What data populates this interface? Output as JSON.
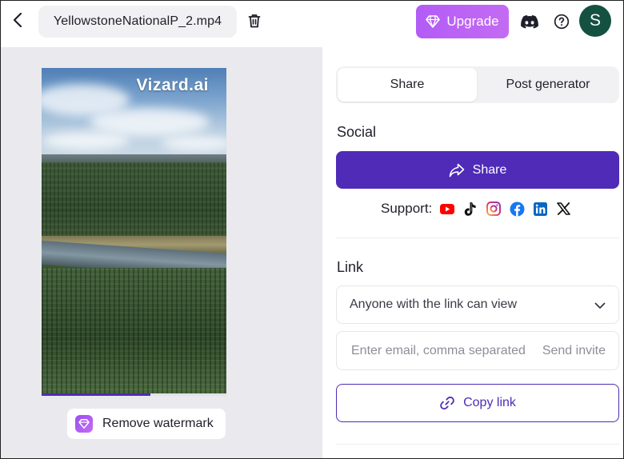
{
  "header": {
    "filename": "YellowstoneNationalP_2.mp4",
    "upgrade_label": "Upgrade",
    "avatar_initial": "S"
  },
  "preview": {
    "watermark_text": "Vizard.ai",
    "progress_fraction": 0.59,
    "remove_watermark_label": "Remove watermark"
  },
  "tabs": [
    {
      "label": "Share",
      "active": true
    },
    {
      "label": "Post generator",
      "active": false
    }
  ],
  "social": {
    "title": "Social",
    "share_label": "Share",
    "support_label": "Support:",
    "platforms": [
      "youtube-icon",
      "tiktok-icon",
      "instagram-icon",
      "facebook-icon",
      "linkedin-icon",
      "x-icon"
    ]
  },
  "link": {
    "title": "Link",
    "access_value": "Anyone with the link can view",
    "invite_placeholder": "Enter email, comma separated",
    "send_invite_label": "Send invite",
    "copy_link_label": "Copy link"
  },
  "colors": {
    "accent": "#4f2bb7",
    "upgrade": "#c065f4",
    "avatar": "#155140"
  }
}
